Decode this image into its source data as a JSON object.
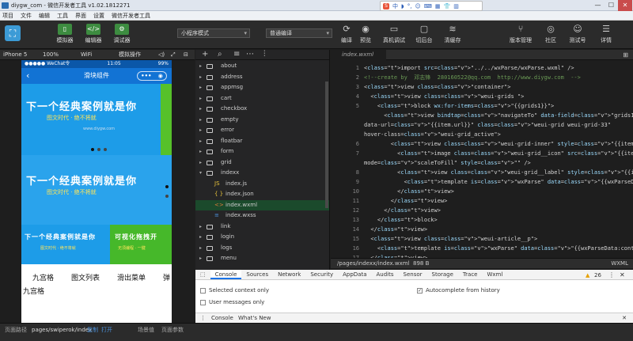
{
  "window": {
    "title": "diygw_com - 微信开发者工具 v1.02.1812271",
    "minimize": "—",
    "maximize": "☐",
    "close": "✕"
  },
  "ime": {
    "logo": "S",
    "items": [
      "中",
      "◗",
      "°,",
      "☺",
      "⌨",
      "▦",
      "👕",
      "▥"
    ]
  },
  "menu": [
    "项目",
    "文件",
    "编辑",
    "工具",
    "界面",
    "设置",
    "微信开发者工具"
  ],
  "toolbar": {
    "simulator": "模拟器",
    "editor": "编辑器",
    "debugger": "调试器",
    "mode": "小程序模式",
    "compile": "普通编译",
    "compile_btn": "编译",
    "preview": "预览",
    "remote_debug": "真机调试",
    "cut_background": "切后台",
    "clear_cache": "清缓存",
    "version": "版本管理",
    "community": "社区",
    "test": "测试号",
    "details": "详情"
  },
  "simbar": {
    "device": "iPhone 5",
    "zoom": "100%",
    "network": "WiFi",
    "simulate": "模拟操作"
  },
  "phone": {
    "carrier": "●●●●● WeChat令",
    "time": "11:05",
    "battery": "99%",
    "nav_title": "滑块组件",
    "banner_text": "下一个经典案例就是你",
    "banner_sub": "图文时代 · 绝不将就",
    "banner_url": "www.diygw.com",
    "banner2_left": "下一个经典案例就是你",
    "banner2_left_sub": "图文时代 · 绝不将就",
    "banner2_right": "可视化拖拽开",
    "banner2_right_sub": "无须编程 · 一键",
    "grids": [
      "九宫格",
      "图文列表",
      "滑出菜单",
      "弹"
    ],
    "grid_title": "九宫格"
  },
  "explorer": {
    "items": [
      {
        "label": "about",
        "type": "folder"
      },
      {
        "label": "address",
        "type": "folder"
      },
      {
        "label": "appmsg",
        "type": "folder"
      },
      {
        "label": "cart",
        "type": "folder"
      },
      {
        "label": "checkbox",
        "type": "folder"
      },
      {
        "label": "empty",
        "type": "folder"
      },
      {
        "label": "error",
        "type": "folder"
      },
      {
        "label": "floatbar",
        "type": "folder"
      },
      {
        "label": "form",
        "type": "folder"
      },
      {
        "label": "grid",
        "type": "folder"
      },
      {
        "label": "indexx",
        "type": "folder-open"
      },
      {
        "label": "index.js",
        "type": "js"
      },
      {
        "label": "index.json",
        "type": "json"
      },
      {
        "label": "index.wxml",
        "type": "wxml",
        "selected": true
      },
      {
        "label": "index.wxss",
        "type": "wxss"
      },
      {
        "label": "link",
        "type": "folder"
      },
      {
        "label": "login",
        "type": "folder"
      },
      {
        "label": "logs",
        "type": "folder"
      },
      {
        "label": "menu",
        "type": "folder"
      }
    ]
  },
  "editor": {
    "tab": "index.wxml",
    "lines": [
      "<import src=\"../../wxParse/wxParse.wxml\" />",
      "<!--create by  邓志锋  280160522@qq.com  http://www.diygw.com  -->",
      "<view class=\"container\">",
      "  <view class=\"weui-grids \">",
      "    <block wx:for-items=\"{{grids1}}\">",
      "      <view bindtap=\"navigateTo\" data-field=\"grids1\" data-index=\"{{index}}\"",
      "data-url=\"{{item.url}}\" class=\"weui-grid weui-grid-33\"",
      "hover-class=\"weui-grid_active\">",
      "        <view class=\"weui-grid-inner\" style=\"{{item.backgroundColor}}\">",
      "          <image class=\"weui-grid__icon\" src=\"{{item.thumb_url}}\"",
      "mode=\"scaleToFill\" style=\"\" />",
      "          <view class=\"weui-grid__label\" style=\"{{item.color}}\">",
      "            <template is=\"wxParse\" data=\"{{wxParseData:item.title.nodes}}\" />",
      "          </view>",
      "        </view>",
      "      </view>",
      "    </block>",
      "  </view>",
      "  <view class=\"weui-article__p\">",
      "    <template is=\"wxParse\" data=\"{{wxParseData:content2.nodes}}\" />",
      "  </view>"
    ],
    "line_numbers": [
      "1",
      "2",
      "3",
      "4",
      "5",
      "",
      "",
      "",
      "6",
      "7",
      "",
      "8",
      "9",
      "10",
      "11",
      "12",
      "13",
      "14",
      "15",
      "16",
      "17"
    ],
    "status_path": "/pages/indexx/index.wxml",
    "status_size": "898 B",
    "status_lang": "WXML"
  },
  "devtools": {
    "tabs": [
      "Console",
      "Sources",
      "Network",
      "Security",
      "AppData",
      "Audits",
      "Sensor",
      "Storage",
      "Trace",
      "Wxml"
    ],
    "warn_count": "26",
    "opt_selected_context": "Selected context only",
    "opt_user_messages": "User messages only",
    "opt_autocomplete": "Autocomplete from history",
    "drawer_tabs": [
      "Console",
      "What's New"
    ]
  },
  "statusbar": {
    "path_label": "页面路径",
    "path": "pages/swiperok/index",
    "copy": "复制",
    "open": "打开",
    "scene": "场景值",
    "params": "页面参数"
  }
}
